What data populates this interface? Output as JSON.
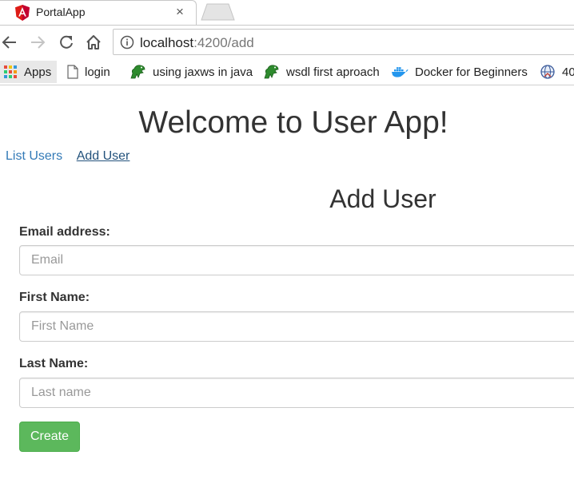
{
  "browser": {
    "tab_title": "PortalApp",
    "tab_close": "×",
    "url_host": "localhost",
    "url_path": ":4200/add",
    "bookmarks": [
      {
        "label": "Apps",
        "icon": "apps-grid-icon"
      },
      {
        "label": "login",
        "icon": "page-icon"
      },
      {
        "label": "using jaxws in java",
        "icon": "dinosaur-icon"
      },
      {
        "label": "wsdl first aproach",
        "icon": "dinosaur-icon"
      },
      {
        "label": "Docker for Beginners",
        "icon": "docker-whale-icon"
      },
      {
        "label": "40",
        "icon": "globe-icon"
      }
    ]
  },
  "page": {
    "title": "Welcome to User App!",
    "nav": {
      "list_users": "List Users",
      "add_user": "Add User"
    }
  },
  "form": {
    "heading": "Add User",
    "email": {
      "label": "Email address:",
      "placeholder": "Email",
      "value": ""
    },
    "first_name": {
      "label": "First Name:",
      "placeholder": "First Name",
      "value": ""
    },
    "last_name": {
      "label": "Last Name:",
      "placeholder": "Last name",
      "value": ""
    },
    "submit_label": "Create"
  },
  "colors": {
    "link": "#337ab7",
    "button_success": "#5cb85c",
    "angular_red": "#dd1b16"
  }
}
